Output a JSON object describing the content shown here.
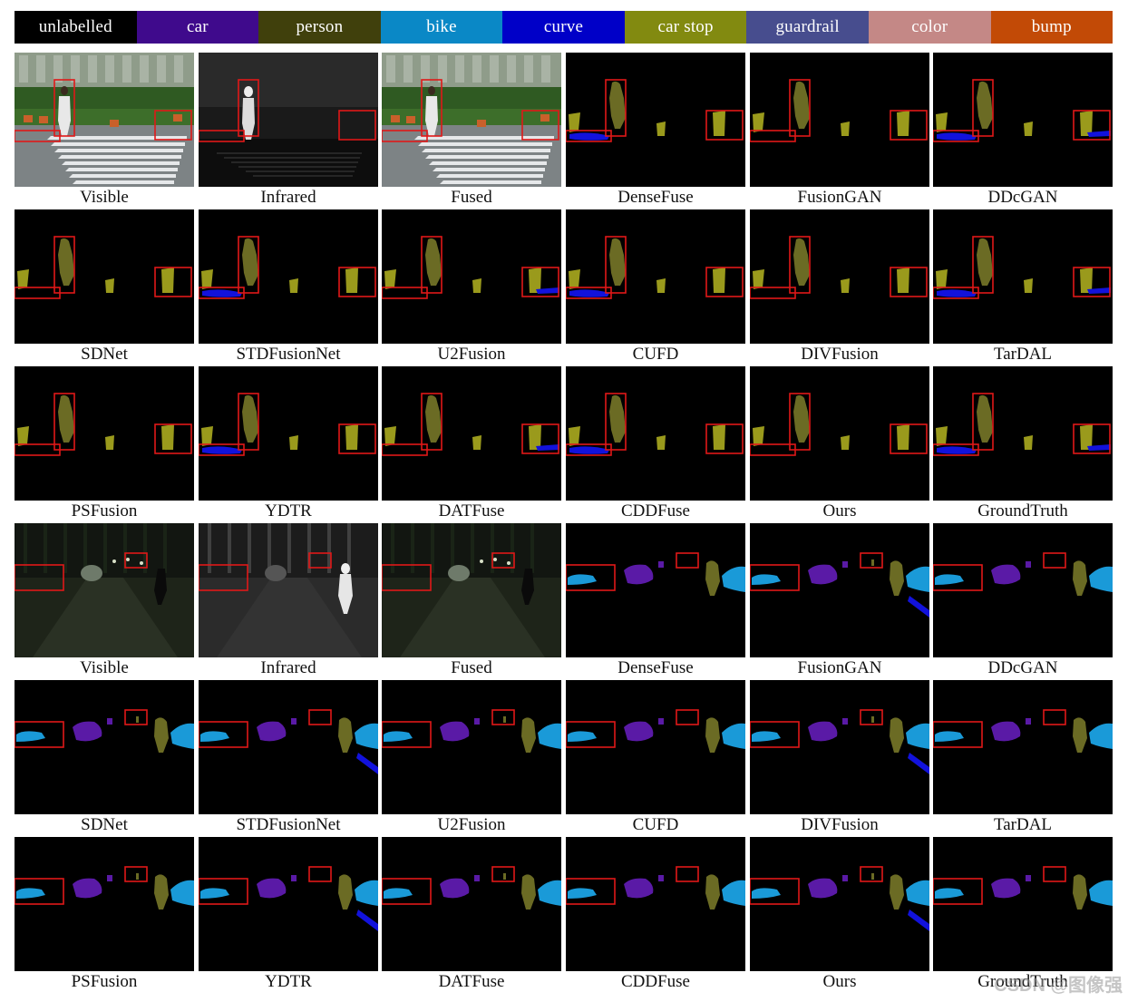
{
  "legend": [
    {
      "label": "unlabelled",
      "color": "#000000"
    },
    {
      "label": "car",
      "color": "#3f0a8c"
    },
    {
      "label": "person",
      "color": "#40400c"
    },
    {
      "label": "bike",
      "color": "#0a88c6"
    },
    {
      "label": "curve",
      "color": "#0000c8"
    },
    {
      "label": "car stop",
      "color": "#828a10"
    },
    {
      "label": "guardrail",
      "color": "#474d8e"
    },
    {
      "label": "color",
      "color": "#c48886"
    },
    {
      "label": "bump",
      "color": "#c24a06"
    }
  ],
  "colors": {
    "person_seg": "#6b6b24",
    "carstop_seg": "#9a9a1c",
    "curve_seg": "#1212dc",
    "bike_seg": "#1a9ad8",
    "car_seg": "#5a1aa6",
    "highlight_box": "#e01818"
  },
  "scenes": [
    {
      "scene": "daytime-crosswalk",
      "rows": [
        [
          "Visible",
          "Infrared",
          "Fused",
          "DenseFuse",
          "FusionGAN",
          "DDcGAN"
        ],
        [
          "SDNet",
          "STDFusionNet",
          "U2Fusion",
          "CUFD",
          "DIVFusion",
          "TarDAL"
        ],
        [
          "PSFusion",
          "YDTR",
          "DATFuse",
          "CDDFuse",
          "Ours",
          "GroundTruth"
        ]
      ]
    },
    {
      "scene": "night-street",
      "rows": [
        [
          "Visible",
          "Infrared",
          "Fused",
          "DenseFuse",
          "FusionGAN",
          "DDcGAN"
        ],
        [
          "SDNet",
          "STDFusionNet",
          "U2Fusion",
          "CUFD",
          "DIVFusion",
          "TarDAL"
        ],
        [
          "PSFusion",
          "YDTR",
          "DATFuse",
          "CDDFuse",
          "Ours",
          "GroundTruth"
        ]
      ]
    }
  ],
  "watermark": "CSDN @图像强"
}
